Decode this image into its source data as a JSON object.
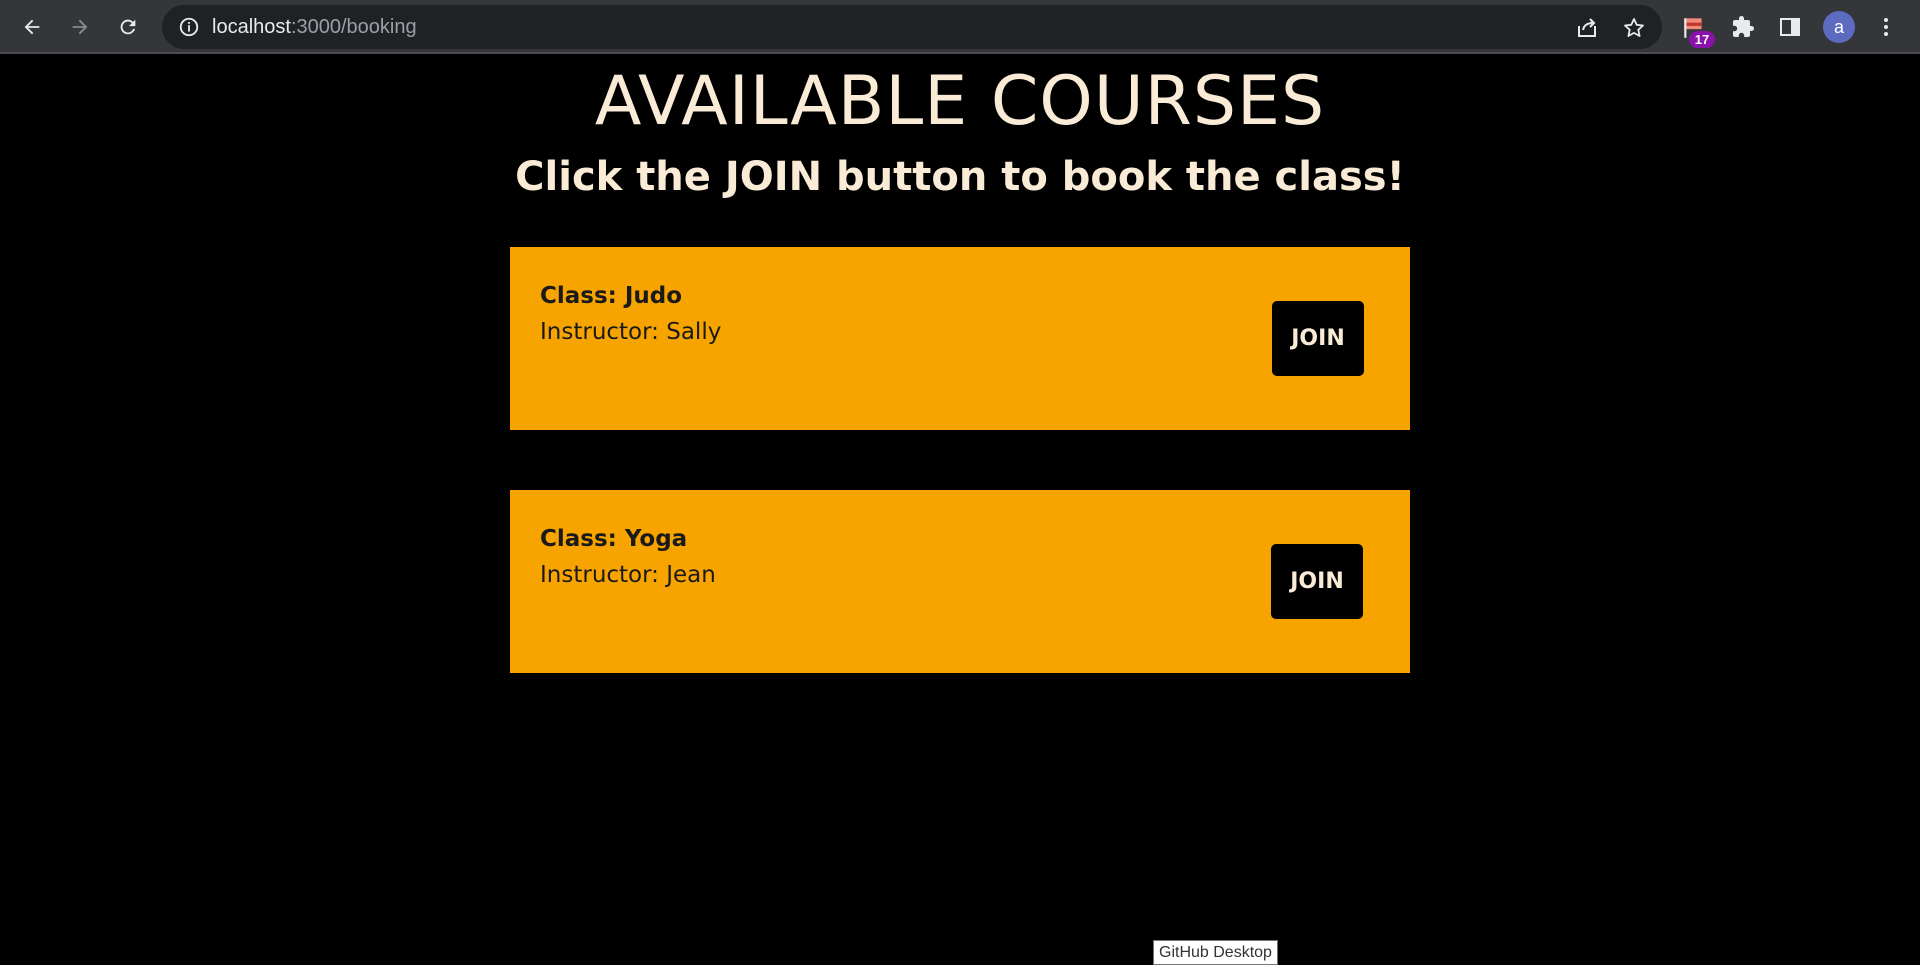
{
  "browser": {
    "url_host": "localhost",
    "url_path": ":3000/booking",
    "extension_badge": "17",
    "profile_initial": "a"
  },
  "page": {
    "title": "AVAILABLE COURSES",
    "subtitle": "Click the JOIN button to book the class!"
  },
  "courses": [
    {
      "class_label": "Class: Judo",
      "instructor_label": "Instructor: Sally",
      "join_label": "JOIN"
    },
    {
      "class_label": "Class: Yoga",
      "instructor_label": "Instructor: Jean",
      "join_label": "JOIN"
    }
  ],
  "tooltip": "GitHub Desktop",
  "colors": {
    "card": "#f7a400",
    "background": "#000000",
    "heading": "#faebd7"
  }
}
